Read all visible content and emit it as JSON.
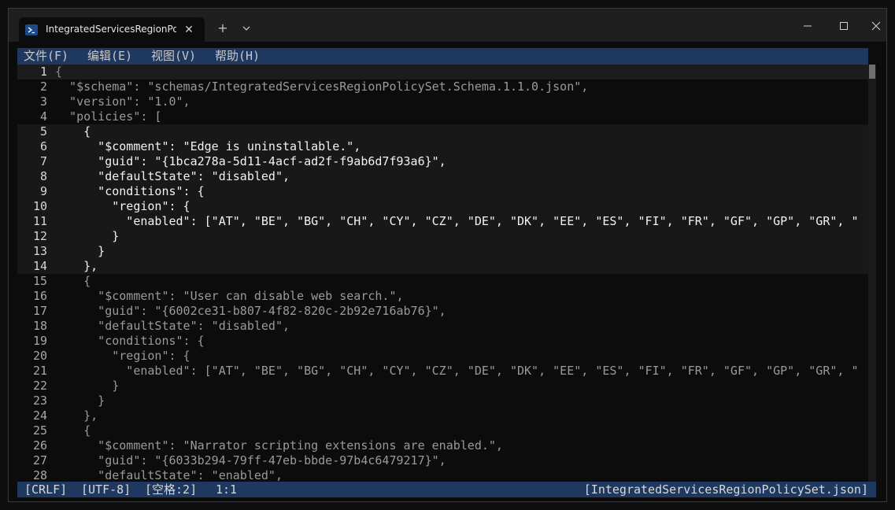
{
  "window": {
    "tab_title": "IntegratedServicesRegionPolicySet.json",
    "tab_close_glyph": "✕",
    "new_tab_glyph": "+",
    "icons": [
      "terminal-icon",
      "close-icon",
      "plus-icon",
      "chevron-down-icon",
      "minimize-icon",
      "maximize-icon",
      "close-window-icon"
    ]
  },
  "menu": {
    "items": [
      "文件(F)",
      "编辑(E)",
      "视图(V)",
      "帮助(H)"
    ]
  },
  "editor": {
    "lines": [
      {
        "n": "1",
        "t": "{"
      },
      {
        "n": "2",
        "t": "  \"$schema\": \"schemas/IntegratedServicesRegionPolicySet.Schema.1.1.0.json\","
      },
      {
        "n": "3",
        "t": "  \"version\": \"1.0\","
      },
      {
        "n": "4",
        "t": "  \"policies\": ["
      },
      {
        "n": "5",
        "t": "    {"
      },
      {
        "n": "6",
        "t": "      \"$comment\": \"Edge is uninstallable.\","
      },
      {
        "n": "7",
        "t": "      \"guid\": \"{1bca278a-5d11-4acf-ad2f-f9ab6d7f93a6}\","
      },
      {
        "n": "8",
        "t": "      \"defaultState\": \"disabled\","
      },
      {
        "n": "9",
        "t": "      \"conditions\": {"
      },
      {
        "n": "10",
        "t": "        \"region\": {"
      },
      {
        "n": "11",
        "t": "          \"enabled\": [\"AT\", \"BE\", \"BG\", \"CH\", \"CY\", \"CZ\", \"DE\", \"DK\", \"EE\", \"ES\", \"FI\", \"FR\", \"GF\", \"GP\", \"GR\", \""
      },
      {
        "n": "12",
        "t": "        }"
      },
      {
        "n": "13",
        "t": "      }"
      },
      {
        "n": "14",
        "t": "    },"
      },
      {
        "n": "15",
        "t": "    {"
      },
      {
        "n": "16",
        "t": "      \"$comment\": \"User can disable web search.\","
      },
      {
        "n": "17",
        "t": "      \"guid\": \"{6002ce31-b807-4f82-820c-2b92e716ab76}\","
      },
      {
        "n": "18",
        "t": "      \"defaultState\": \"disabled\","
      },
      {
        "n": "19",
        "t": "      \"conditions\": {"
      },
      {
        "n": "20",
        "t": "        \"region\": {"
      },
      {
        "n": "21",
        "t": "          \"enabled\": [\"AT\", \"BE\", \"BG\", \"CH\", \"CY\", \"CZ\", \"DE\", \"DK\", \"EE\", \"ES\", \"FI\", \"FR\", \"GF\", \"GP\", \"GR\", \""
      },
      {
        "n": "22",
        "t": "        }"
      },
      {
        "n": "23",
        "t": "      }"
      },
      {
        "n": "24",
        "t": "    },"
      },
      {
        "n": "25",
        "t": "    {"
      },
      {
        "n": "26",
        "t": "      \"$comment\": \"Narrator scripting extensions are enabled.\","
      },
      {
        "n": "27",
        "t": "      \"guid\": \"{6033b294-79ff-47eb-bbde-97b4c6479217}\","
      },
      {
        "n": "28",
        "t": "      \"defaultState\": \"enabled\","
      }
    ]
  },
  "status": {
    "line_ending": "[CRLF]",
    "encoding": "[UTF-8]",
    "indent": "[空格:2]",
    "cursor": "1:1",
    "filename": "[IntegratedServicesRegionPolicySet.json]"
  },
  "colors": {
    "menubar": "#1f3860",
    "statusbar": "#1f3860",
    "editor_bg": "#0c0c0c",
    "highlight_block": "#181818"
  }
}
